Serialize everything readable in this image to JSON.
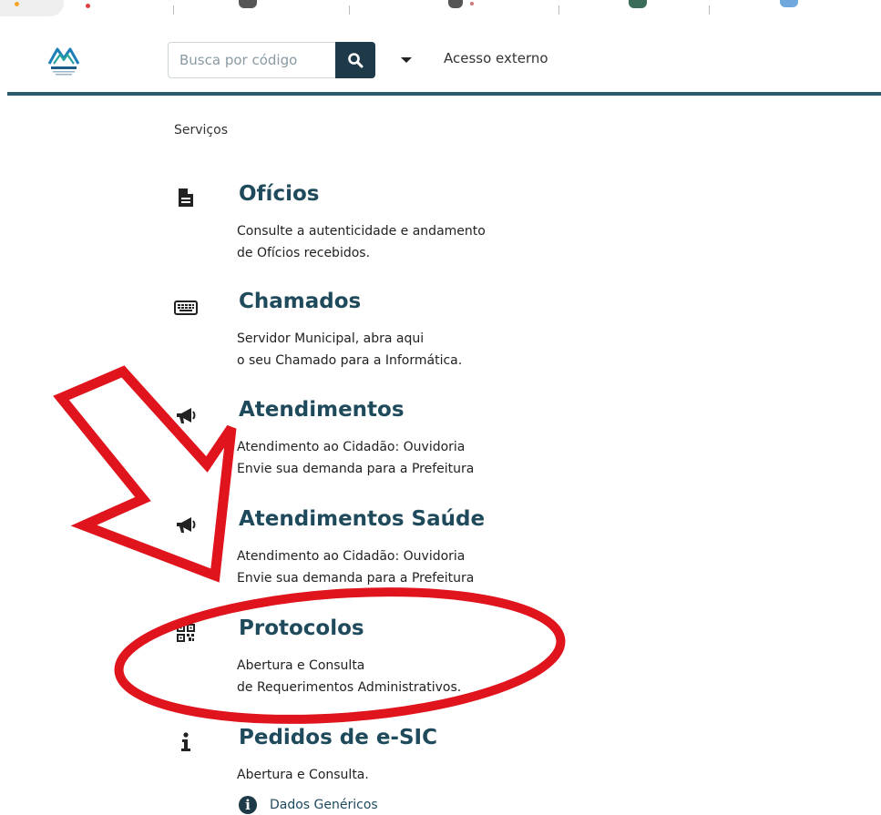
{
  "header": {
    "search": {
      "placeholder": "Busca por código"
    },
    "external_link": "Acesso externo",
    "icons": {
      "logo": "martinopolis-logo-icon",
      "search": "search-icon",
      "caret": "caret-down-icon"
    }
  },
  "breadcrumb": "Serviços",
  "services": [
    {
      "title": "Ofícios",
      "icon": "file-icon",
      "description": [
        "Consulte a autenticidade e andamento",
        "de Ofícios recebidos."
      ]
    },
    {
      "title": "Chamados",
      "icon": "keyboard-icon",
      "description": [
        "Servidor Municipal, abra aqui",
        "o seu Chamado para a Informática."
      ]
    },
    {
      "title": "Atendimentos",
      "icon": "bullhorn-icon",
      "description": [
        "Atendimento ao Cidadão: Ouvidoria",
        "Envie sua demanda para a Prefeitura"
      ]
    },
    {
      "title": "Atendimentos Saúde",
      "icon": "bullhorn-icon",
      "description": [
        "Atendimento ao Cidadão: Ouvidoria",
        "Envie sua demanda para a Prefeitura"
      ]
    },
    {
      "title": "Protocolos",
      "icon": "qrcode-icon",
      "description": [
        "Abertura e Consulta",
        "de Requerimentos Administrativos."
      ]
    },
    {
      "title": "Pedidos de e-SIC",
      "icon": "info-icon",
      "description": [
        "Abertura e Consulta."
      ]
    }
  ],
  "generic_link": {
    "label": "Dados Genéricos",
    "icon": "info-circle-icon"
  },
  "colors": {
    "heading": "#1e4a5c",
    "button": "#1e3947",
    "header_line": "#2a5a6b",
    "annotation": "#e0141c"
  }
}
